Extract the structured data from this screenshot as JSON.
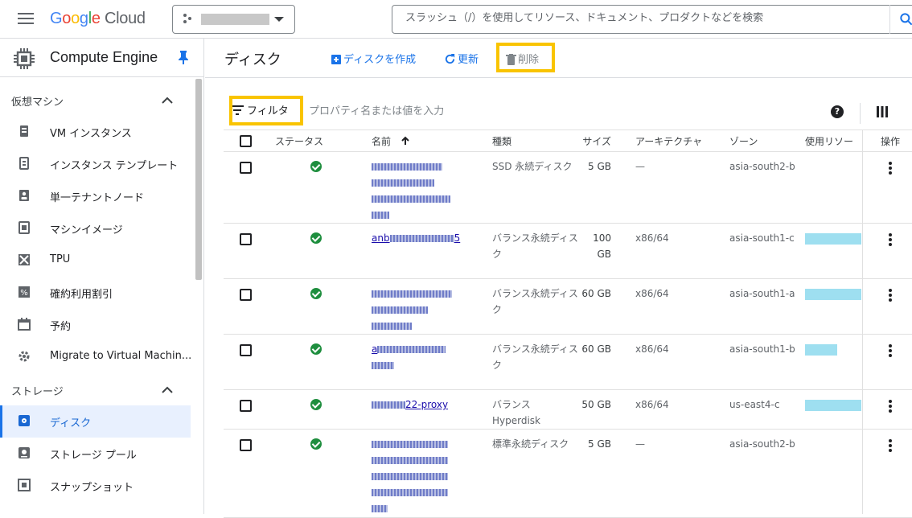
{
  "header": {
    "logo_google": "Google",
    "logo_cloud": "Cloud",
    "search_placeholder": "スラッシュ（/）を使用してリソース、ドキュメント、プロダクトなどを検索"
  },
  "sidebar": {
    "title": "Compute Engine",
    "sections": [
      {
        "label": "仮想マシン",
        "items": [
          {
            "label": "VM インスタンス",
            "icon": "vm-instance-icon"
          },
          {
            "label": "インスタンス テンプレート",
            "icon": "instance-template-icon"
          },
          {
            "label": "単一テナントノード",
            "icon": "sole-tenant-node-icon"
          },
          {
            "label": "マシンイメージ",
            "icon": "machine-image-icon"
          },
          {
            "label": "TPU",
            "icon": "tpu-icon"
          },
          {
            "label": "確約利用割引",
            "icon": "percent-icon"
          },
          {
            "label": "予約",
            "icon": "calendar-icon"
          },
          {
            "label": "Migrate to Virtual Machin...",
            "icon": "migrate-icon"
          }
        ]
      },
      {
        "label": "ストレージ",
        "items": [
          {
            "label": "ディスク",
            "icon": "disk-icon",
            "active": true
          },
          {
            "label": "ストレージ プール",
            "icon": "storage-pool-icon"
          },
          {
            "label": "スナップショット",
            "icon": "snapshot-icon"
          }
        ]
      }
    ]
  },
  "toolbar": {
    "title": "ディスク",
    "create_label": "ディスクを作成",
    "refresh_label": "更新",
    "delete_label": "削除"
  },
  "filter": {
    "label": "フィルタ",
    "placeholder": "プロパティ名または値を入力"
  },
  "table": {
    "headers": {
      "status": "ステータス",
      "name": "名前",
      "type": "種類",
      "size": "サイズ",
      "arch": "アーキテクチャ",
      "zone": "ゾーン",
      "usedby": "使用リソー",
      "actions": "操作"
    },
    "rows": [
      {
        "name_suffix": "",
        "type": "SSD 永続ディスク",
        "size": "5 GB",
        "arch": "—",
        "zone": "asia-south2-b",
        "used": false
      },
      {
        "name_prefix": "anb",
        "name_suffix": "5",
        "type": "バランス永続ディスク",
        "size": "100 GB",
        "arch": "x86/64",
        "zone": "asia-south1-c",
        "used": true
      },
      {
        "name_suffix": "",
        "type": "バランス永続ディスク",
        "size": "60 GB",
        "arch": "x86/64",
        "zone": "asia-south1-a",
        "used": true
      },
      {
        "name_prefix": "a",
        "name_suffix": "",
        "type": "バランス永続ディスク",
        "size": "60 GB",
        "arch": "x86/64",
        "zone": "asia-south1-b",
        "used": true
      },
      {
        "name_suffix": "22-proxy",
        "type": "バランス Hyperdisk",
        "size": "50 GB",
        "arch": "x86/64",
        "zone": "us-east4-c",
        "used": true
      },
      {
        "name_suffix": "",
        "type": "標準永続ディスク",
        "size": "5 GB",
        "arch": "—",
        "zone": "asia-south2-b",
        "used": false
      }
    ]
  }
}
